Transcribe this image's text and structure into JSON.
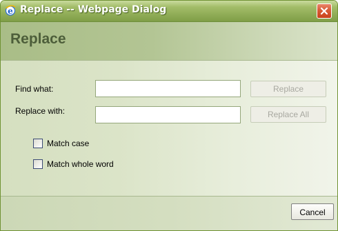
{
  "window": {
    "title": "Replace -- Webpage Dialog",
    "app_icon": "internet-explorer-icon",
    "close_icon": "close-icon"
  },
  "header": {
    "title": "Replace"
  },
  "form": {
    "find_label": "Find what:",
    "find_value": "",
    "replace_label": "Replace with:",
    "replace_value": "",
    "replace_button": "Replace",
    "replace_all_button": "Replace All",
    "match_case_label": "Match case",
    "match_case_checked": false,
    "match_whole_word_label": "Match whole word",
    "match_whole_word_checked": false
  },
  "footer": {
    "cancel_button": "Cancel"
  },
  "colors": {
    "title_bar": "#8eab55",
    "close_button": "#d85b35",
    "header_title": "#4d5e3a",
    "disabled_text": "#a8a8a0"
  }
}
